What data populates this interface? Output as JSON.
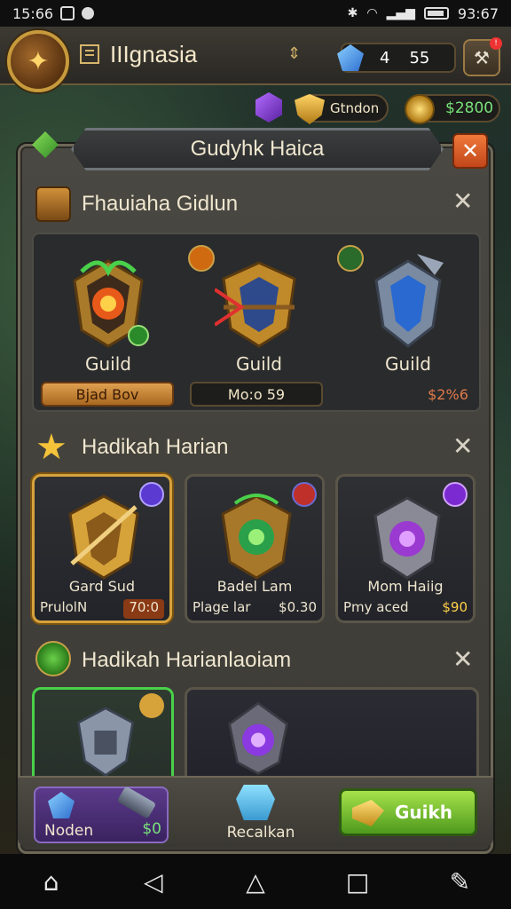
{
  "status_bar": {
    "time": "15:66",
    "clock": "93:67"
  },
  "header": {
    "app_title": "IIIgnasia",
    "gems_a": "4",
    "gems_b": "55",
    "shields": "Gtndon",
    "coins": "$2800"
  },
  "panel": {
    "title": "Gudyhk Haica"
  },
  "section1": {
    "title": "Fhauiaha Gidlun",
    "items": [
      {
        "label": "Guild",
        "button": "Bjad Bov"
      },
      {
        "label": "Guild",
        "button": "Mo:o 59"
      },
      {
        "label": "Guild",
        "button": "$2%6"
      }
    ]
  },
  "section2": {
    "title": "Hadikah Harian",
    "cards": [
      {
        "name": "Gard Sud",
        "sub": "PrulolN",
        "price": "70:0"
      },
      {
        "name": "Badel Lam",
        "sub": "Plage lar",
        "price": "$0.30"
      },
      {
        "name": "Mom Haiig",
        "sub": "Pmy aced",
        "price": "$90"
      }
    ]
  },
  "section3": {
    "title": "Hadikah Harianlaoiam"
  },
  "action_bar": {
    "mod_label": "Noden",
    "mod_value": "$0",
    "recall_label": "Recalkan",
    "guild_label": "Guikh"
  },
  "colors": {
    "accent_green": "#79e27a",
    "close_orange": "#e0612a",
    "gold": "#d6b56a",
    "panel_bg": "#43413b"
  }
}
